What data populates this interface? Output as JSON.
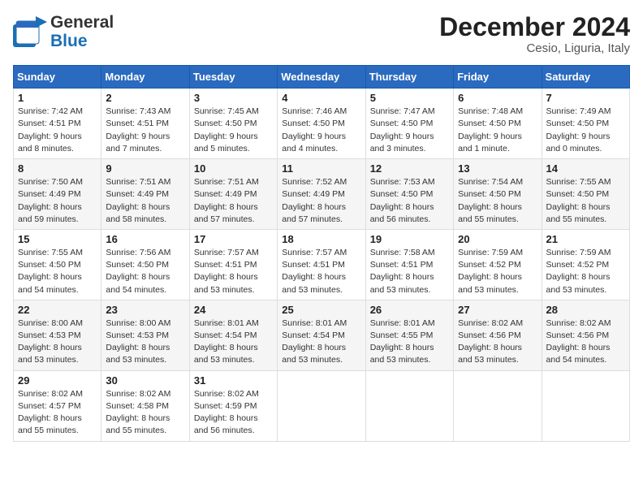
{
  "header": {
    "logo_general": "General",
    "logo_blue": "Blue",
    "month": "December 2024",
    "location": "Cesio, Liguria, Italy"
  },
  "days_of_week": [
    "Sunday",
    "Monday",
    "Tuesday",
    "Wednesday",
    "Thursday",
    "Friday",
    "Saturday"
  ],
  "weeks": [
    [
      {
        "day": "1",
        "sunrise": "Sunrise: 7:42 AM",
        "sunset": "Sunset: 4:51 PM",
        "daylight": "Daylight: 9 hours and 8 minutes."
      },
      {
        "day": "2",
        "sunrise": "Sunrise: 7:43 AM",
        "sunset": "Sunset: 4:51 PM",
        "daylight": "Daylight: 9 hours and 7 minutes."
      },
      {
        "day": "3",
        "sunrise": "Sunrise: 7:45 AM",
        "sunset": "Sunset: 4:50 PM",
        "daylight": "Daylight: 9 hours and 5 minutes."
      },
      {
        "day": "4",
        "sunrise": "Sunrise: 7:46 AM",
        "sunset": "Sunset: 4:50 PM",
        "daylight": "Daylight: 9 hours and 4 minutes."
      },
      {
        "day": "5",
        "sunrise": "Sunrise: 7:47 AM",
        "sunset": "Sunset: 4:50 PM",
        "daylight": "Daylight: 9 hours and 3 minutes."
      },
      {
        "day": "6",
        "sunrise": "Sunrise: 7:48 AM",
        "sunset": "Sunset: 4:50 PM",
        "daylight": "Daylight: 9 hours and 1 minute."
      },
      {
        "day": "7",
        "sunrise": "Sunrise: 7:49 AM",
        "sunset": "Sunset: 4:50 PM",
        "daylight": "Daylight: 9 hours and 0 minutes."
      }
    ],
    [
      {
        "day": "8",
        "sunrise": "Sunrise: 7:50 AM",
        "sunset": "Sunset: 4:49 PM",
        "daylight": "Daylight: 8 hours and 59 minutes."
      },
      {
        "day": "9",
        "sunrise": "Sunrise: 7:51 AM",
        "sunset": "Sunset: 4:49 PM",
        "daylight": "Daylight: 8 hours and 58 minutes."
      },
      {
        "day": "10",
        "sunrise": "Sunrise: 7:51 AM",
        "sunset": "Sunset: 4:49 PM",
        "daylight": "Daylight: 8 hours and 57 minutes."
      },
      {
        "day": "11",
        "sunrise": "Sunrise: 7:52 AM",
        "sunset": "Sunset: 4:49 PM",
        "daylight": "Daylight: 8 hours and 57 minutes."
      },
      {
        "day": "12",
        "sunrise": "Sunrise: 7:53 AM",
        "sunset": "Sunset: 4:50 PM",
        "daylight": "Daylight: 8 hours and 56 minutes."
      },
      {
        "day": "13",
        "sunrise": "Sunrise: 7:54 AM",
        "sunset": "Sunset: 4:50 PM",
        "daylight": "Daylight: 8 hours and 55 minutes."
      },
      {
        "day": "14",
        "sunrise": "Sunrise: 7:55 AM",
        "sunset": "Sunset: 4:50 PM",
        "daylight": "Daylight: 8 hours and 55 minutes."
      }
    ],
    [
      {
        "day": "15",
        "sunrise": "Sunrise: 7:55 AM",
        "sunset": "Sunset: 4:50 PM",
        "daylight": "Daylight: 8 hours and 54 minutes."
      },
      {
        "day": "16",
        "sunrise": "Sunrise: 7:56 AM",
        "sunset": "Sunset: 4:50 PM",
        "daylight": "Daylight: 8 hours and 54 minutes."
      },
      {
        "day": "17",
        "sunrise": "Sunrise: 7:57 AM",
        "sunset": "Sunset: 4:51 PM",
        "daylight": "Daylight: 8 hours and 53 minutes."
      },
      {
        "day": "18",
        "sunrise": "Sunrise: 7:57 AM",
        "sunset": "Sunset: 4:51 PM",
        "daylight": "Daylight: 8 hours and 53 minutes."
      },
      {
        "day": "19",
        "sunrise": "Sunrise: 7:58 AM",
        "sunset": "Sunset: 4:51 PM",
        "daylight": "Daylight: 8 hours and 53 minutes."
      },
      {
        "day": "20",
        "sunrise": "Sunrise: 7:59 AM",
        "sunset": "Sunset: 4:52 PM",
        "daylight": "Daylight: 8 hours and 53 minutes."
      },
      {
        "day": "21",
        "sunrise": "Sunrise: 7:59 AM",
        "sunset": "Sunset: 4:52 PM",
        "daylight": "Daylight: 8 hours and 53 minutes."
      }
    ],
    [
      {
        "day": "22",
        "sunrise": "Sunrise: 8:00 AM",
        "sunset": "Sunset: 4:53 PM",
        "daylight": "Daylight: 8 hours and 53 minutes."
      },
      {
        "day": "23",
        "sunrise": "Sunrise: 8:00 AM",
        "sunset": "Sunset: 4:53 PM",
        "daylight": "Daylight: 8 hours and 53 minutes."
      },
      {
        "day": "24",
        "sunrise": "Sunrise: 8:01 AM",
        "sunset": "Sunset: 4:54 PM",
        "daylight": "Daylight: 8 hours and 53 minutes."
      },
      {
        "day": "25",
        "sunrise": "Sunrise: 8:01 AM",
        "sunset": "Sunset: 4:54 PM",
        "daylight": "Daylight: 8 hours and 53 minutes."
      },
      {
        "day": "26",
        "sunrise": "Sunrise: 8:01 AM",
        "sunset": "Sunset: 4:55 PM",
        "daylight": "Daylight: 8 hours and 53 minutes."
      },
      {
        "day": "27",
        "sunrise": "Sunrise: 8:02 AM",
        "sunset": "Sunset: 4:56 PM",
        "daylight": "Daylight: 8 hours and 53 minutes."
      },
      {
        "day": "28",
        "sunrise": "Sunrise: 8:02 AM",
        "sunset": "Sunset: 4:56 PM",
        "daylight": "Daylight: 8 hours and 54 minutes."
      }
    ],
    [
      {
        "day": "29",
        "sunrise": "Sunrise: 8:02 AM",
        "sunset": "Sunset: 4:57 PM",
        "daylight": "Daylight: 8 hours and 55 minutes."
      },
      {
        "day": "30",
        "sunrise": "Sunrise: 8:02 AM",
        "sunset": "Sunset: 4:58 PM",
        "daylight": "Daylight: 8 hours and 55 minutes."
      },
      {
        "day": "31",
        "sunrise": "Sunrise: 8:02 AM",
        "sunset": "Sunset: 4:59 PM",
        "daylight": "Daylight: 8 hours and 56 minutes."
      },
      null,
      null,
      null,
      null
    ]
  ]
}
